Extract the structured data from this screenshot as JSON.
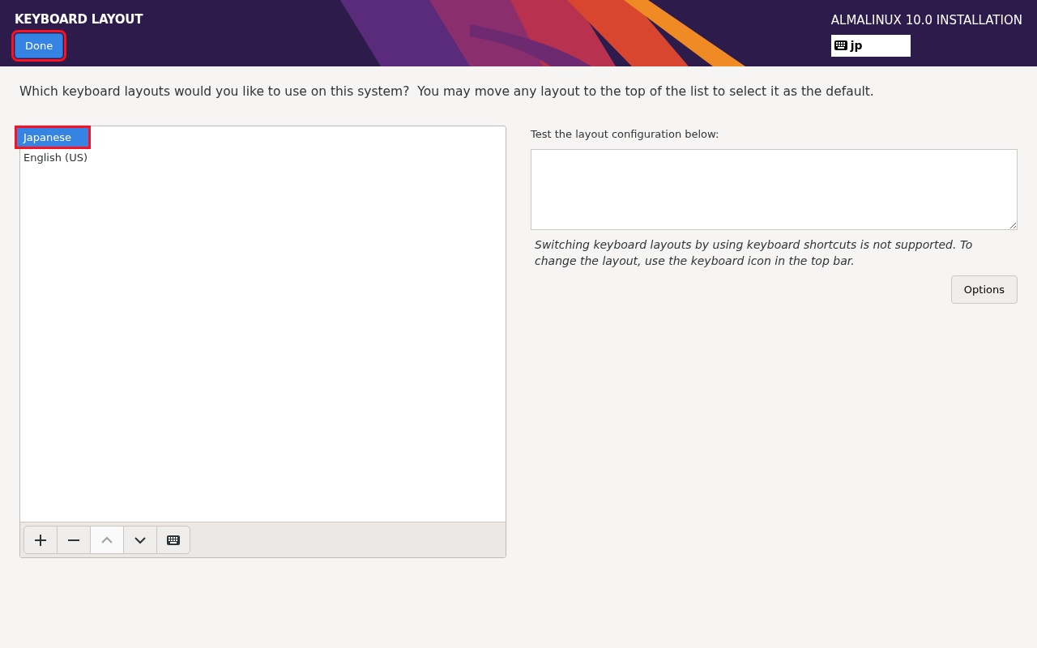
{
  "header": {
    "title": "KEYBOARD LAYOUT",
    "done_button": {
      "label": "Done",
      "highlighted": true
    },
    "product": "ALMALINUX 10.0 INSTALLATION",
    "layout_indicator": "jp"
  },
  "instructions": "Which keyboard layouts would you like to use on this system?  You may move any layout to the top of the list to select it as the default.",
  "layouts": [
    {
      "label": "Japanese",
      "selected": true,
      "highlighted": true
    },
    {
      "label": "English (US)",
      "selected": false,
      "highlighted": false
    }
  ],
  "toolbar": [
    {
      "kind": "add",
      "disabled": false
    },
    {
      "kind": "remove",
      "disabled": false
    },
    {
      "kind": "up",
      "disabled": true
    },
    {
      "kind": "down",
      "disabled": false
    },
    {
      "kind": "keyboard",
      "disabled": false
    }
  ],
  "test": {
    "label": "Test the layout configuration below:",
    "note": "Switching keyboard layouts by using keyboard shortcuts is not supported. To change the layout, use the keyboard icon in the top bar.",
    "options_button": "Options"
  }
}
